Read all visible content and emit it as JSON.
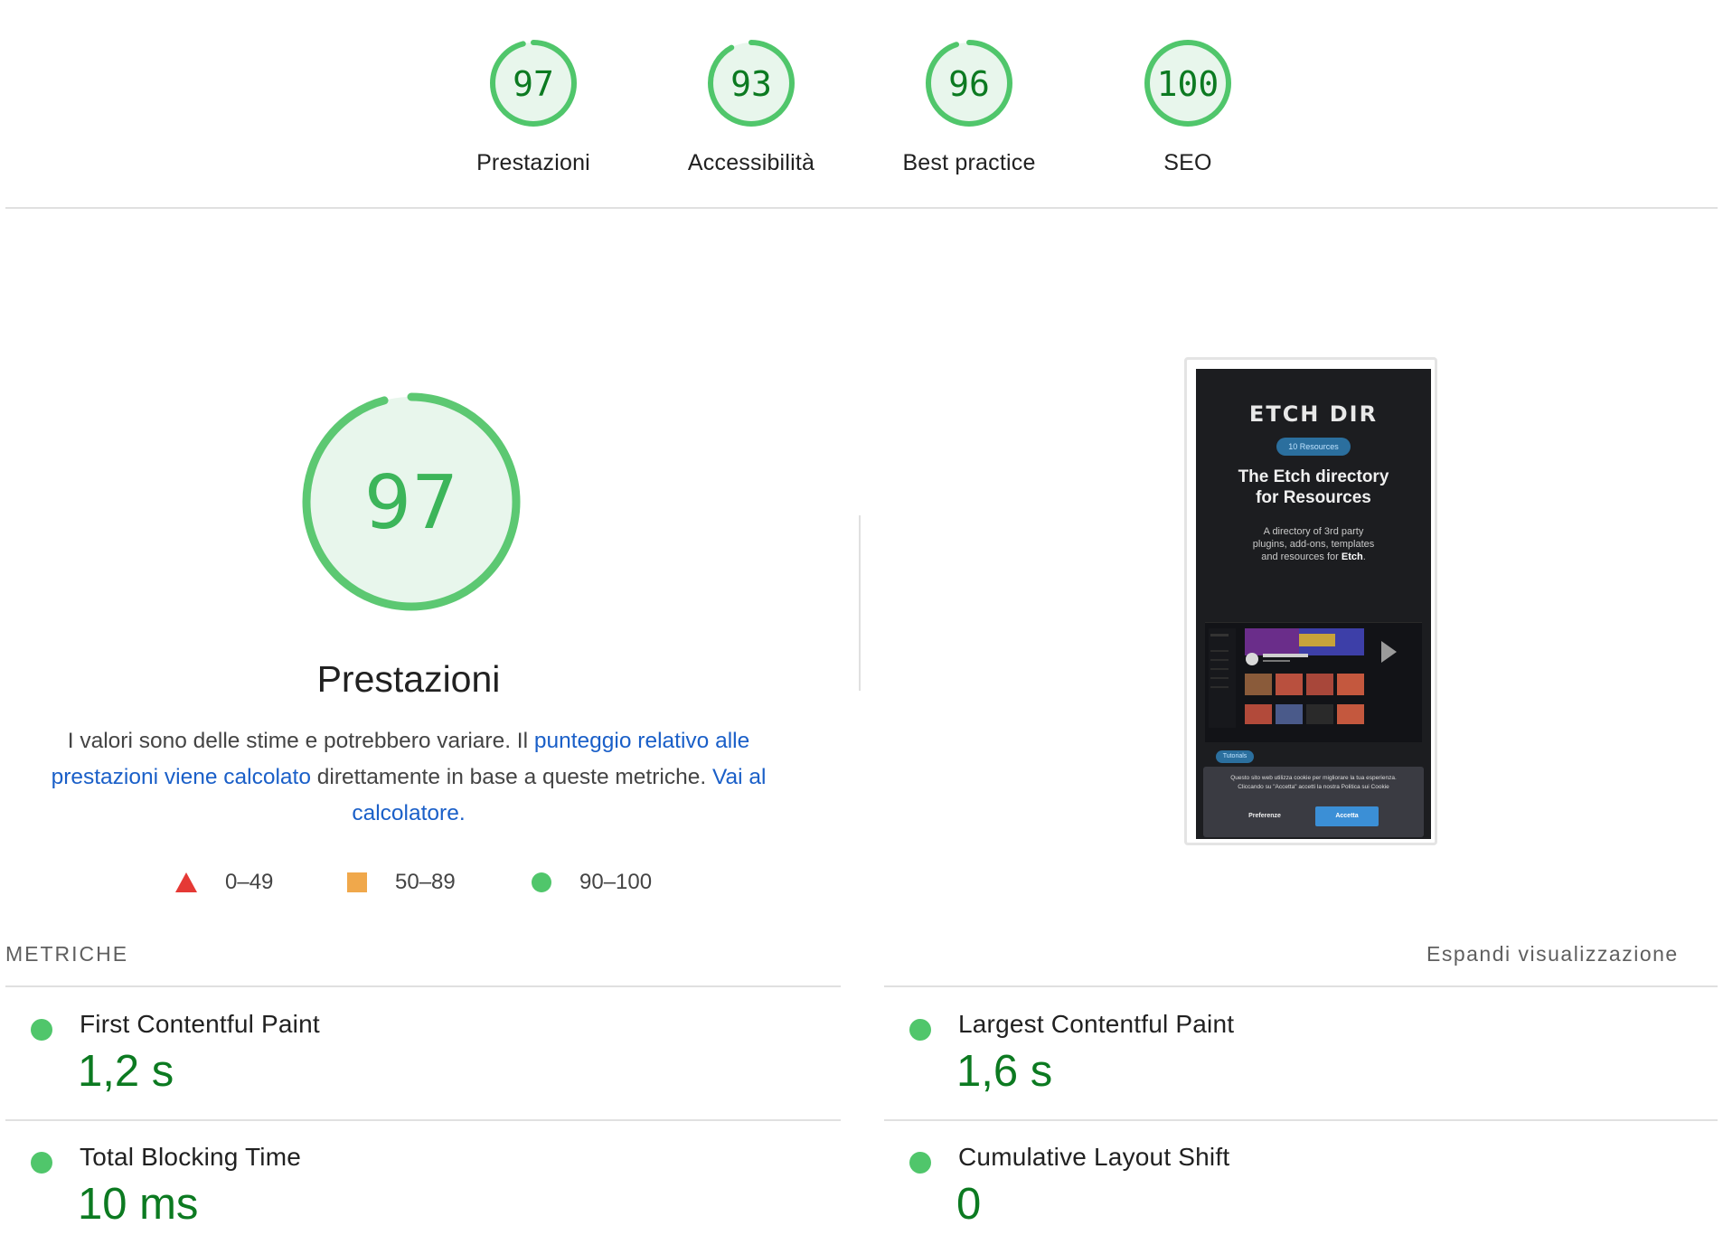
{
  "categories": [
    {
      "score": "97",
      "label": "Prestazioni",
      "fraction": 0.97
    },
    {
      "score": "93",
      "label": "Accessibilità",
      "fraction": 0.93
    },
    {
      "score": "96",
      "label": "Best practice",
      "fraction": 0.96
    },
    {
      "score": "100",
      "label": "SEO",
      "fraction": 1.0
    }
  ],
  "performance": {
    "score": "97",
    "fraction": 0.97,
    "title": "Prestazioni",
    "desc_text_1": "I valori sono delle stime e potrebbero variare. Il ",
    "desc_link_1": "punteggio relativo alle prestazioni viene calcolato",
    "desc_text_2": " direttamente in base a queste metriche. ",
    "desc_link_2": "Vai al calcolatore."
  },
  "legend": [
    {
      "range": "0–49",
      "color": "#e53935"
    },
    {
      "range": "50–89",
      "color": "#f0a84b"
    },
    {
      "range": "90–100",
      "color": "#50c66b"
    }
  ],
  "screenshot": {
    "logo": "ETCH DIR",
    "pill": "10 Resources",
    "headline_1": "The Etch directory",
    "headline_2": "for Resources",
    "sub_1": "A directory of 3rd party",
    "sub_2": "plugins, add-ons, templates",
    "sub_3": "and resources for ",
    "sub_bold": "Etch",
    "tag": "Tutorials",
    "cookie_text_1": "Questo sito web utilizza cookie per migliorare la tua esperienza.",
    "cookie_text_2": "Cliccando su \"Accetta\" accetti la nostra Politica sui Cookie",
    "cookie_pref": "Preferenze",
    "cookie_accept": "Accetta"
  },
  "metrics_section": {
    "label": "METRICHE",
    "expand": "Espandi visualizzazione"
  },
  "metrics": [
    {
      "name": "First Contentful Paint",
      "value": "1,2 s"
    },
    {
      "name": "Largest Contentful Paint",
      "value": "1,6 s"
    },
    {
      "name": "Total Blocking Time",
      "value": "10 ms"
    },
    {
      "name": "Cumulative Layout Shift",
      "value": "0"
    }
  ],
  "colors": {
    "pass": "#50c66b",
    "pass_fill": "#e8f6ec",
    "pass_text": "#0c7a21",
    "link": "#1a5fc8"
  }
}
